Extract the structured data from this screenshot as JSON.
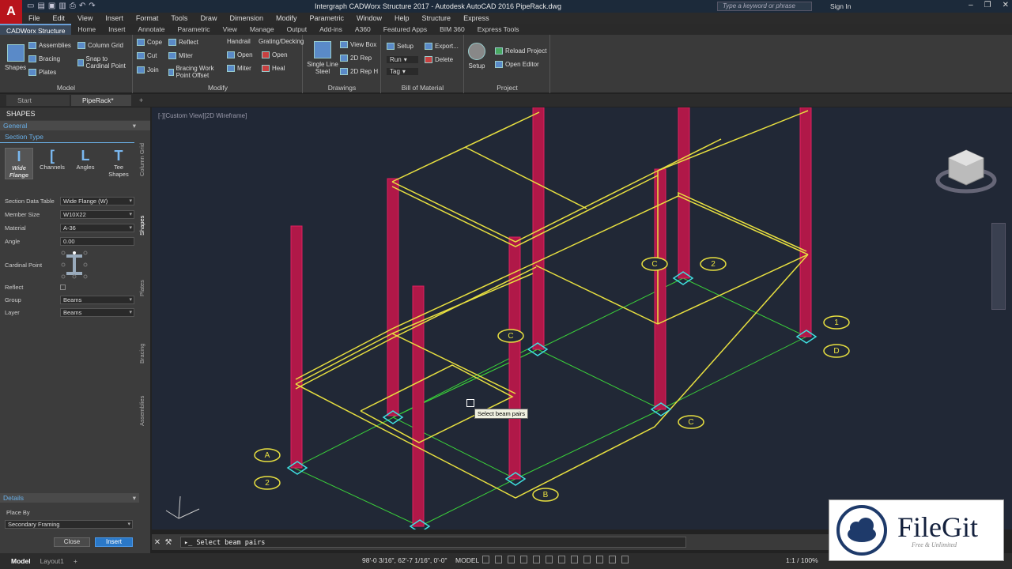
{
  "app": {
    "logo_letter": "A",
    "title": "Intergraph CADWorx Structure 2017 - Autodesk AutoCAD 2016   PipeRack.dwg",
    "search_placeholder": "Type a keyword or phrase",
    "sign_in": "Sign In"
  },
  "menu": [
    "File",
    "Edit",
    "View",
    "Insert",
    "Format",
    "Tools",
    "Draw",
    "Dimension",
    "Modify",
    "Parametric",
    "Window",
    "Help",
    "Structure",
    "Express"
  ],
  "ribbon_tabs": [
    "CADWorx Structure",
    "Home",
    "Insert",
    "Annotate",
    "Parametric",
    "View",
    "Manage",
    "Output",
    "Add-ins",
    "A360",
    "Featured Apps",
    "BIM 360",
    "Express Tools"
  ],
  "ribbon": {
    "model": {
      "title": "Model",
      "shapes": "Shapes",
      "assemblies": "Assemblies",
      "bracing": "Bracing",
      "plates": "Plates",
      "column_grid": "Column Grid",
      "snap": "Snap to Cardinal Point"
    },
    "modify": {
      "title": "Modify",
      "cope": "Cope",
      "reflect": "Reflect",
      "cut": "Cut",
      "miter": "Miter",
      "join": "Join",
      "bracing_offset": "Bracing Work Point Offset",
      "handrail": "Handrail",
      "open": "Open",
      "miter2": "Miter",
      "grating": "Grating/Decking",
      "open2": "Open",
      "heal": "Heal"
    },
    "drawings": {
      "title": "Drawings",
      "single_line": "Single Line Steel",
      "view_box": "View Box",
      "rep2d": "2D Rep",
      "rep2dh": "2D Rep H"
    },
    "bom": {
      "title": "Bill of Material",
      "setup": "Setup",
      "export": "Export...",
      "run": "Run",
      "delete": "Delete",
      "tag": "Tag"
    },
    "project": {
      "title": "Project",
      "setup": "Setup",
      "reload": "Reload Project",
      "open_editor": "Open Editor"
    }
  },
  "file_tabs": [
    "Start",
    "PipeRack*"
  ],
  "palette": {
    "header": "SHAPES",
    "general": "General",
    "section_type": "Section Type",
    "types": [
      {
        "label": "Wide Flange",
        "sym": "I"
      },
      {
        "label": "Channels",
        "sym": "["
      },
      {
        "label": "Angles",
        "sym": "L"
      },
      {
        "label": "Tee Shapes",
        "sym": "T"
      }
    ],
    "props": [
      {
        "label": "Section Data Table",
        "value": "Wide Flange (W)"
      },
      {
        "label": "Member Size",
        "value": "W10X22"
      },
      {
        "label": "Material",
        "value": "A-36"
      },
      {
        "label": "Angle",
        "value": "0.00"
      }
    ],
    "cardinal_point": "Cardinal Point",
    "reflect": "Reflect",
    "group_label": "Group",
    "group_value": "Beams",
    "layer_label": "Layer",
    "layer_value": "Beams",
    "details": "Details",
    "place_by": "Place By",
    "place_by_value": "Secondary Framing",
    "close": "Close",
    "insert": "Insert",
    "side_tabs": [
      "Column Grid",
      "Shapes",
      "Plates",
      "Bracing",
      "Assemblies"
    ]
  },
  "viewport": {
    "label": "[-][Custom View][2D Wireframe]",
    "tooltip": "Select beam pairs",
    "grid_labels": [
      "1",
      "2",
      "A",
      "2",
      "B",
      "C",
      "D",
      "1",
      "2",
      "C",
      "C"
    ]
  },
  "command": {
    "text": "Select beam pairs"
  },
  "status": {
    "layouts": [
      "Model",
      "Layout1"
    ],
    "coords": "98'-0 3/16\", 62'-7 1/16\", 0'-0\"",
    "model": "MODEL",
    "zoom": "1:1 / 100%"
  },
  "watermark": {
    "title": "FileGit",
    "subtitle": "Free & Unlimited"
  }
}
